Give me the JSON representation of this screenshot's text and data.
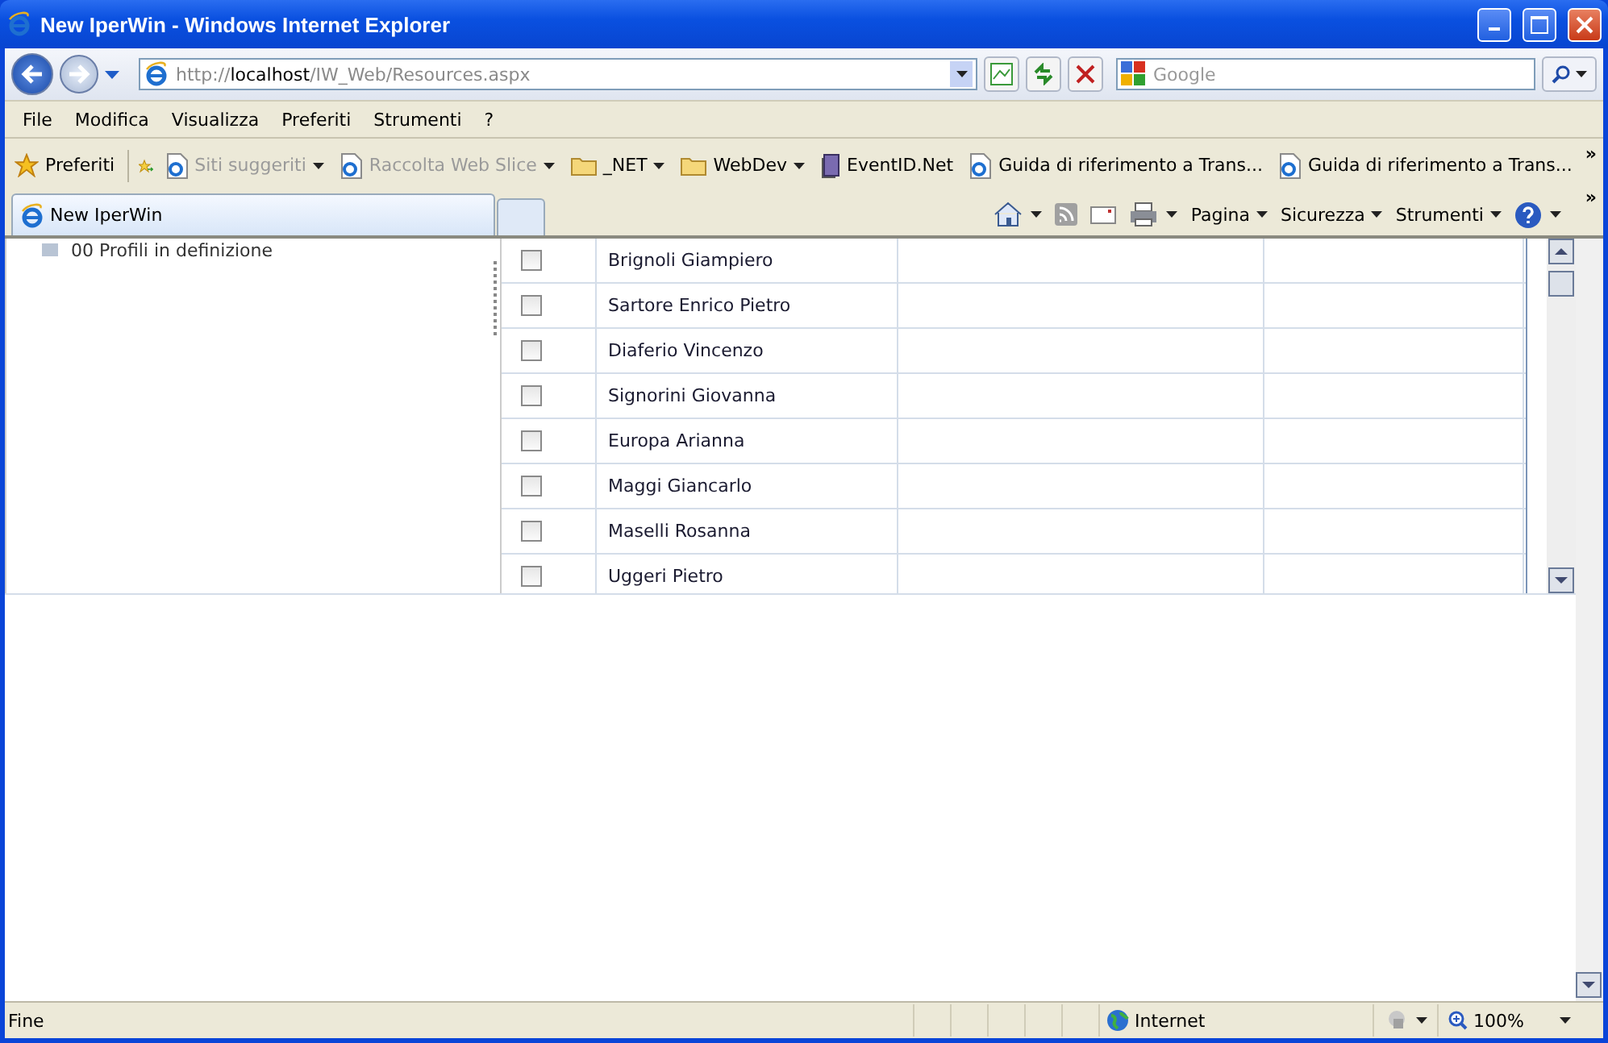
{
  "window": {
    "title": "New IperWin - Windows Internet Explorer"
  },
  "address": {
    "scheme": "http://",
    "host": "localhost",
    "path": "/IW_Web/Resources.aspx"
  },
  "search": {
    "placeholder": "Google"
  },
  "menu": [
    "File",
    "Modifica",
    "Visualizza",
    "Preferiti",
    "Strumenti",
    "?"
  ],
  "favorites_bar": {
    "favorites_label": "Preferiti",
    "items": [
      {
        "label": "Siti suggeriti",
        "kind": "page",
        "dropdown": true,
        "disabled": true
      },
      {
        "label": "Raccolta Web Slice",
        "kind": "page",
        "dropdown": true,
        "disabled": true
      },
      {
        "label": "_NET",
        "kind": "folder",
        "dropdown": true,
        "disabled": false
      },
      {
        "label": "WebDev",
        "kind": "folder",
        "dropdown": true,
        "disabled": false
      },
      {
        "label": "EventID.Net",
        "kind": "book",
        "dropdown": false,
        "disabled": false
      },
      {
        "label": "Guida di riferimento a Trans...",
        "kind": "page",
        "dropdown": false,
        "disabled": false
      },
      {
        "label": "Guida di riferimento a Trans...",
        "kind": "page",
        "dropdown": false,
        "disabled": false
      }
    ],
    "more": "»"
  },
  "tabs": [
    {
      "label": "New IperWin",
      "selected": true
    }
  ],
  "command_bar": {
    "items": [
      "Pagina",
      "Sicurezza",
      "Strumenti"
    ],
    "more": "»"
  },
  "tree": {
    "items": [
      {
        "label": "00 Profili in definizione"
      }
    ]
  },
  "grid": {
    "rows": [
      {
        "checked": false,
        "name": "Brignoli Giampiero"
      },
      {
        "checked": false,
        "name": "Sartore Enrico Pietro"
      },
      {
        "checked": false,
        "name": "Diaferio Vincenzo"
      },
      {
        "checked": false,
        "name": "Signorini Giovanna"
      },
      {
        "checked": false,
        "name": "Europa Arianna"
      },
      {
        "checked": false,
        "name": "Maggi Giancarlo"
      },
      {
        "checked": false,
        "name": "Maselli Rosanna"
      },
      {
        "checked": false,
        "name": "Uggeri Pietro"
      }
    ]
  },
  "status_bar": {
    "text": "Fine",
    "zone": "Internet",
    "zoom": "100%"
  }
}
